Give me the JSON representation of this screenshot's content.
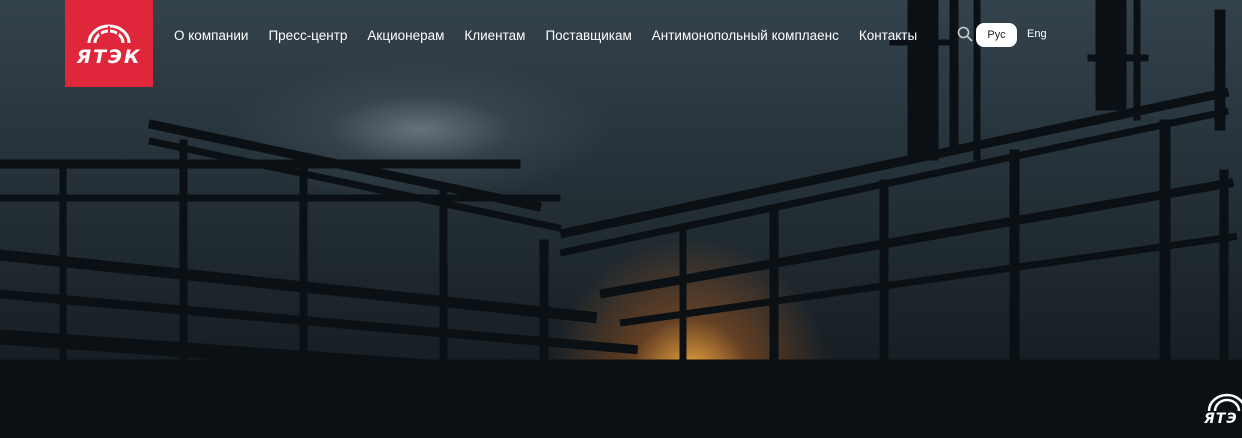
{
  "logo": {
    "text": "ЯТЭК",
    "color": "#e0263a"
  },
  "nav": {
    "items": [
      {
        "label": "О компании"
      },
      {
        "label": "Пресс-центр"
      },
      {
        "label": "Акционерам"
      },
      {
        "label": "Клиентам"
      },
      {
        "label": "Поставщикам"
      },
      {
        "label": "Антимонопольный комплаенс"
      },
      {
        "label": "Контакты"
      }
    ]
  },
  "search": {
    "icon": "search-icon"
  },
  "languages": {
    "active": "Рус",
    "other": "Eng"
  },
  "corner_logo": {
    "text": "ЯТЭ"
  }
}
